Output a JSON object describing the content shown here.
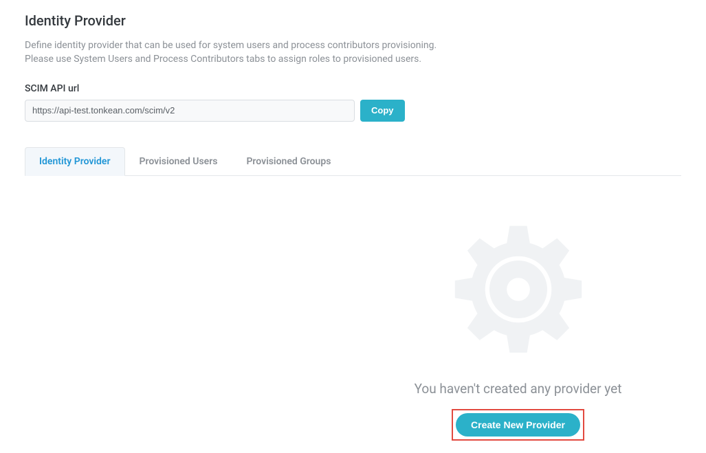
{
  "header": {
    "title": "Identity Provider",
    "description_line1": "Define identity provider that can be used for system users and process contributors provisioning.",
    "description_line2": "Please use System Users and Process Contributors tabs to assign roles to provisioned users."
  },
  "scim": {
    "label": "SCIM API url",
    "value": "https://api-test.tonkean.com/scim/v2",
    "copy_label": "Copy"
  },
  "tabs": {
    "items": [
      {
        "label": "Identity Provider",
        "active": true
      },
      {
        "label": "Provisioned Users",
        "active": false
      },
      {
        "label": "Provisioned Groups",
        "active": false
      }
    ]
  },
  "empty_state": {
    "message": "You haven't created any provider yet",
    "button_label": "Create New Provider"
  }
}
